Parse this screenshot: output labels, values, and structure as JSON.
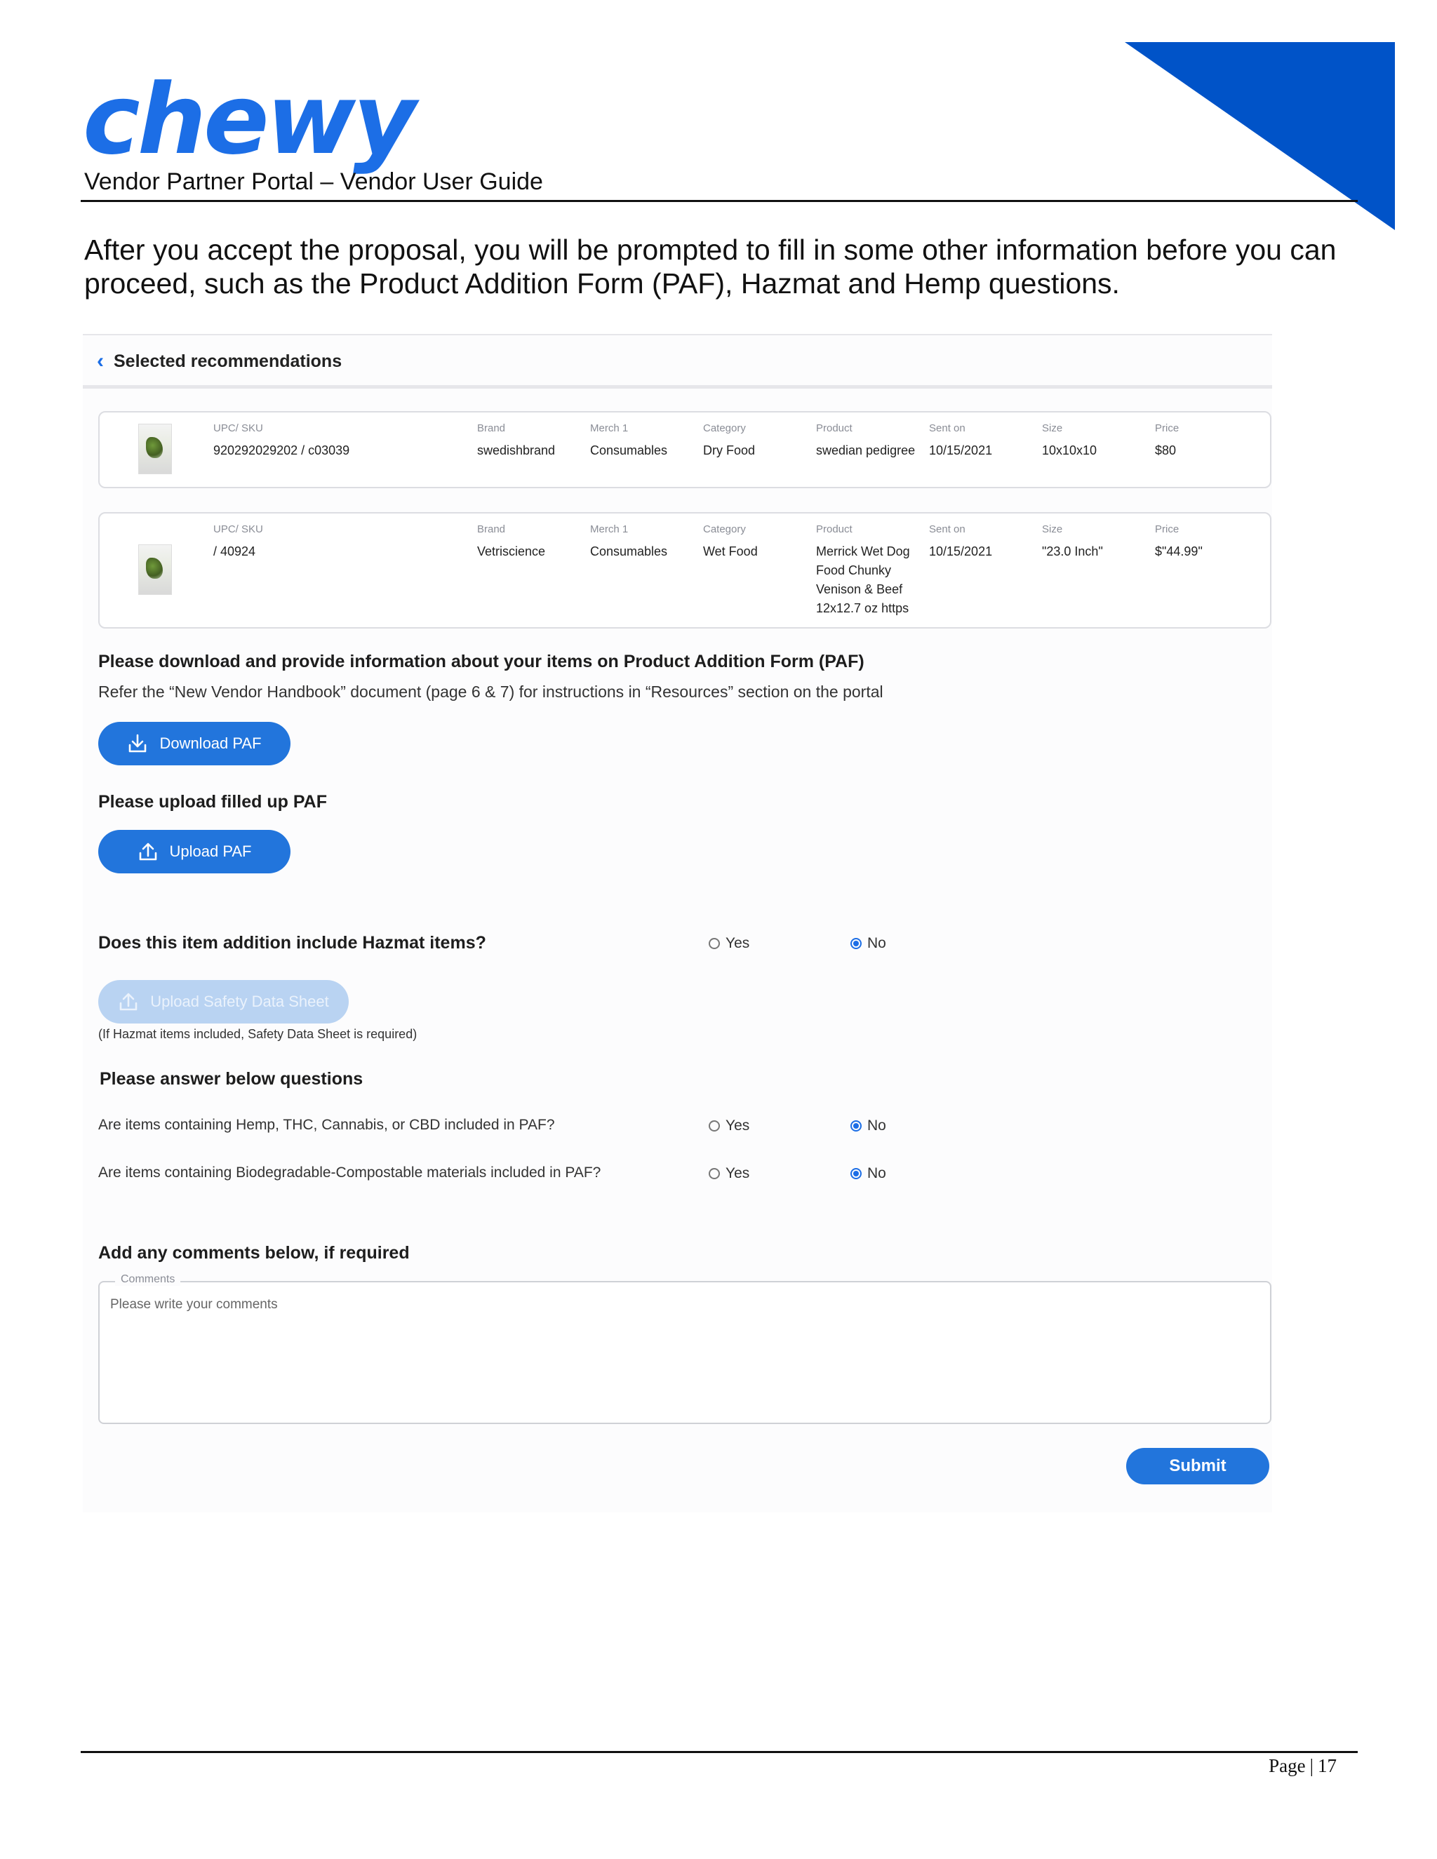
{
  "header": {
    "logo_text": "chewy",
    "subtitle": "Vendor Partner Portal – Vendor User Guide",
    "brand_color": "#1c6ee6",
    "corner_color": "#0053c8"
  },
  "intro": "After you accept the proposal, you will be prompted to fill in some other information before you can proceed, such as the Product Addition Form (PAF), Hazmat and Hemp questions.",
  "app": {
    "back_label": "Selected recommendations",
    "columns": {
      "upc": "UPC/ SKU",
      "brand": "Brand",
      "merch": "Merch 1",
      "category": "Category",
      "product": "Product",
      "sent": "Sent on",
      "size": "Size",
      "price": "Price"
    },
    "items": [
      {
        "upc": "920292029202 / c03039",
        "brand": "swedishbrand",
        "merch": "Consumables",
        "category": "Dry Food",
        "product": "swedian pedigree",
        "sent": "10/15/2021",
        "size": "10x10x10",
        "price": "$80"
      },
      {
        "upc": "/ 40924",
        "brand": "Vetriscience",
        "merch": "Consumables",
        "category": "Wet Food",
        "product": "Merrick Wet Dog Food Chunky Venison & Beef 12x12.7 oz https",
        "sent": "10/15/2021",
        "size": "\"23.0 Inch\"",
        "price": "$\"44.99\""
      }
    ],
    "paf": {
      "heading": "Please download and provide information about your items on Product Addition Form (PAF)",
      "instructions": "Refer the “New Vendor Handbook” document (page 6 & 7) for instructions in “Resources” section on the portal",
      "download_label": "Download PAF",
      "upload_heading": "Please upload filled up PAF",
      "upload_label": "Upload PAF"
    },
    "hazmat": {
      "question": "Does this item addition include Hazmat items?",
      "yes": "Yes",
      "no": "No",
      "selected": "No",
      "sds_label": "Upload Safety Data Sheet",
      "note": "(If Hazmat items included, Safety Data Sheet is required)"
    },
    "questions": {
      "heading": "Please answer below questions",
      "items": [
        {
          "text": "Are items containing Hemp, THC, Cannabis, or CBD included in PAF?",
          "yes": "Yes",
          "no": "No",
          "selected": "No"
        },
        {
          "text": "Are items containing Biodegradable-Compostable materials included in PAF?",
          "yes": "Yes",
          "no": "No",
          "selected": "No"
        }
      ]
    },
    "comments": {
      "heading": "Add any comments below, if required",
      "legend": "Comments",
      "placeholder": "Please write your comments"
    },
    "submit_label": "Submit"
  },
  "footer": {
    "page_label": "Page",
    "separator": "|",
    "page_number": "17"
  }
}
